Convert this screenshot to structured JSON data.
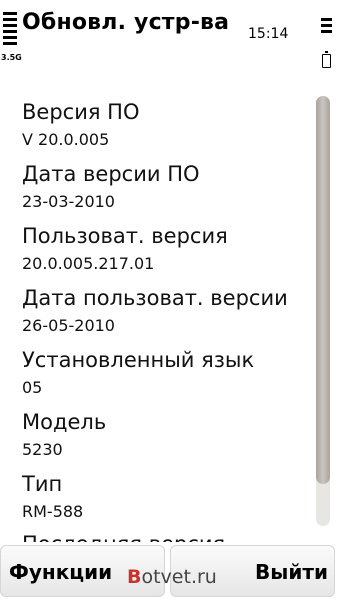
{
  "status": {
    "title": "Обновл. устр-ва",
    "time": "15:14",
    "network": "3.5G"
  },
  "items": [
    {
      "label": "Версия ПО",
      "value": "V 20.0.005"
    },
    {
      "label": "Дата версии ПО",
      "value": "23-03-2010"
    },
    {
      "label": "Пользоват. версия",
      "value": "20.0.005.217.01"
    },
    {
      "label": "Дата пользоват. версии",
      "value": "26-05-2010"
    },
    {
      "label": "Установленный язык",
      "value": "05"
    },
    {
      "label": "Модель",
      "value": "5230"
    },
    {
      "label": "Тип",
      "value": "RM-588"
    },
    {
      "label": "Последняя версия",
      "value": ""
    }
  ],
  "softkeys": {
    "left": "Функции",
    "right": "Выйти"
  },
  "watermark": {
    "first_letter": "B",
    "rest": "otvet.ru"
  }
}
